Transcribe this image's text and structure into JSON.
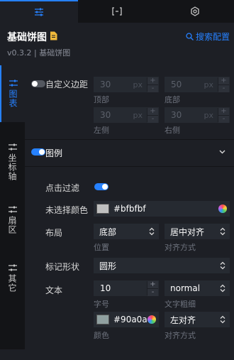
{
  "tabs": [
    {
      "name": "sliders-icon"
    },
    {
      "name": "bracket-icon"
    },
    {
      "name": "refresh-icon"
    }
  ],
  "header": {
    "title": "基础饼图",
    "version": "v0.3.2 | 基础饼图",
    "search_label": "搜索配置"
  },
  "sidenav": {
    "items": [
      {
        "label": "图表"
      },
      {
        "label": "坐标轴"
      },
      {
        "label": "扇区"
      },
      {
        "label": "其它"
      }
    ]
  },
  "margin": {
    "label": "自定义边距",
    "enabled": false,
    "top": {
      "value": "30",
      "unit": "px",
      "caption": "顶部"
    },
    "bottom": {
      "value": "50",
      "unit": "px",
      "caption": "底部"
    },
    "left": {
      "value": "30",
      "unit": "px",
      "caption": "左侧"
    },
    "right": {
      "value": "30",
      "unit": "px",
      "caption": "右侧"
    }
  },
  "legend": {
    "label": "图例",
    "enabled": true,
    "click_filter": {
      "label": "点击过滤",
      "enabled": true
    },
    "unselected_color": {
      "label": "未选择颜色",
      "value": "#bfbfbf",
      "swatch": "#bfbfbf"
    },
    "layout": {
      "label": "布局",
      "position": {
        "value": "底部",
        "caption": "位置"
      },
      "align": {
        "value": "居中对齐",
        "caption": "对齐方式"
      }
    },
    "marker": {
      "label": "标记形状",
      "value": "圆形"
    },
    "text": {
      "label": "文本",
      "font_size": {
        "value": "10",
        "caption": "字号"
      },
      "font_weight": {
        "value": "normal",
        "caption": "文字粗细"
      },
      "color": {
        "value": "#90a0a0",
        "display": "#90a0a",
        "swatch": "#90a0a0",
        "caption": "颜色"
      },
      "align": {
        "value": "左对齐",
        "caption": "对齐方式"
      }
    }
  },
  "colors": {
    "accent": "#2681ff",
    "panel": "#1d1f25",
    "sidebar": "#131417",
    "input": "#262a31"
  }
}
